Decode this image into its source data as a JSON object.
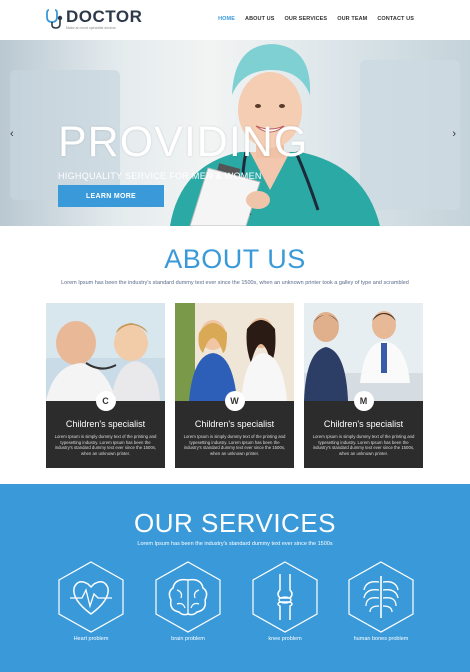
{
  "logo": {
    "title": "DOCTOR",
    "tagline": "Make an most specialist doctors"
  },
  "nav": [
    "HOME",
    "ABOUT US",
    "OUR SERVICES",
    "OUR TEAM",
    "CONTACT US"
  ],
  "hero": {
    "title": "PROVIDING",
    "subtitle": "HIGHQUALITY SERVICE FOR MEN & WOMEN",
    "button": "LEARN MORE",
    "prev": "‹",
    "next": "›"
  },
  "about": {
    "title": "ABOUT US",
    "description": "Lorem Ipsum has been the industry's standard dummy text ever since the 1500s, when an unknown printer took a galley of type and scrambled",
    "cards": [
      {
        "badge": "C",
        "title": "Children's specialist",
        "text": "Lorem Ipsum is simply dummy text of the printing and typesetting industry. Lorem Ipsum has been the industry's standard dummy text ever since the 1500s, when an unknown printer."
      },
      {
        "badge": "W",
        "title": "Children's specialist",
        "text": "Lorem Ipsum is simply dummy text of the printing and typesetting industry. Lorem Ipsum has been the industry's standard dummy text ever since the 1500s, when an unknown printer."
      },
      {
        "badge": "M",
        "title": "Children's specialist",
        "text": "Lorem Ipsum is simply dummy text of the printing and typesetting industry. Lorem Ipsum has been the industry's standard dummy text ever since the 1500s, when an unknown printer."
      }
    ]
  },
  "services": {
    "title": "OUR SERVICES",
    "description": "Lorem Ipsum has been the industry's standard dummy text ever since the 1500s",
    "items": [
      {
        "label": "Heart problem",
        "icon": "heart-icon"
      },
      {
        "label": "brain problem",
        "icon": "brain-icon"
      },
      {
        "label": "knee problem",
        "icon": "knee-icon"
      },
      {
        "label": "human bones problem",
        "icon": "ribcage-icon"
      }
    ]
  },
  "colors": {
    "accent": "#3a9ad9",
    "card_bg": "#2c2c2c"
  }
}
